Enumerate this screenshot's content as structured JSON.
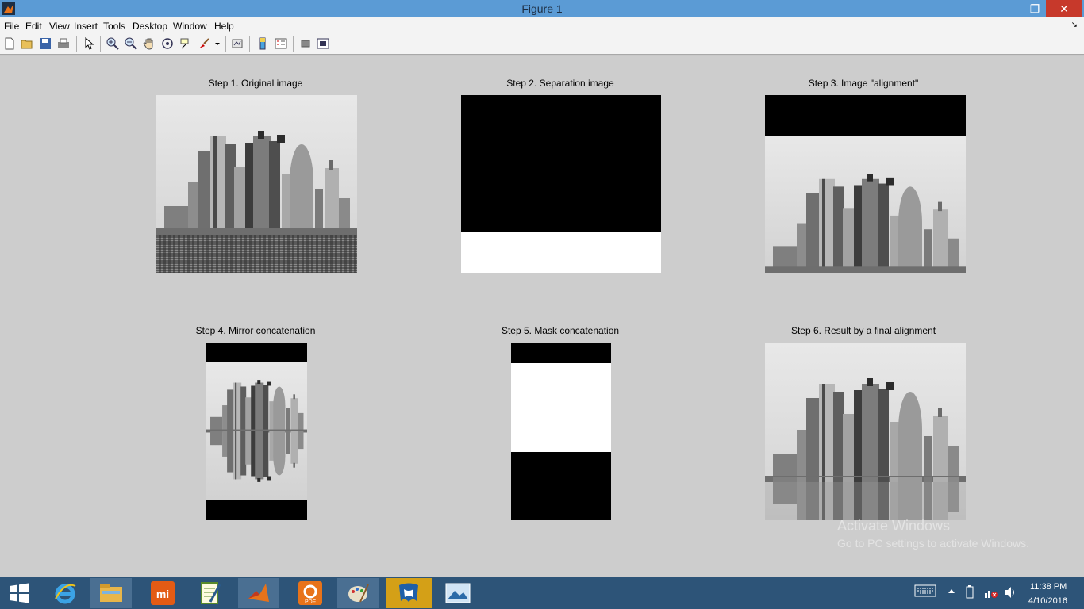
{
  "window": {
    "title": "Figure 1",
    "minimize_glyph": "—",
    "restore_glyph": "❐",
    "close_glyph": "✕"
  },
  "menu": {
    "items": [
      "File",
      "Edit",
      "View",
      "Insert",
      "Tools",
      "Desktop",
      "Window",
      "Help"
    ],
    "dock_glyph": "↘"
  },
  "toolbar": {
    "icons": [
      "new-figure-icon",
      "open-file-icon",
      "save-icon",
      "print-icon",
      "edit-plot-icon",
      "zoom-in-icon",
      "zoom-out-icon",
      "pan-icon",
      "rotate-3d-icon",
      "data-cursor-icon",
      "brush-icon",
      "link-plot-icon",
      "insert-colorbar-icon",
      "insert-legend-icon",
      "hide-plot-tools-icon",
      "show-plot-tools-icon"
    ]
  },
  "subplots": {
    "step1": {
      "title": "Step 1. Original image"
    },
    "step2": {
      "title": "Step 2. Separation image"
    },
    "step3": {
      "title": "Step 3. Image \"alignment\""
    },
    "step4": {
      "title": "Step 4. Mirror concatenation"
    },
    "step5": {
      "title": "Step 5. Mask concatenation"
    },
    "step6": {
      "title": "Step 6. Result by a final alignment"
    }
  },
  "watermark": {
    "line1": "Activate Windows",
    "line2": "Go to PC settings to activate Windows."
  },
  "taskbar": {
    "apps": [
      "windows-start-icon",
      "internet-explorer-icon",
      "file-explorer-icon",
      "mi-app-icon",
      "notepad-icon",
      "matlab-icon",
      "pdf-app-icon",
      "paint-icon",
      "malwarebytes-icon",
      "photo-viewer-icon"
    ],
    "time": "11:38 PM",
    "date": "4/10/2016"
  },
  "colors": {
    "titlebar": "#5b9bd5",
    "figure_bg": "#cdcdcd",
    "taskbar": "#2d5478",
    "active_task": "#d4a017"
  }
}
